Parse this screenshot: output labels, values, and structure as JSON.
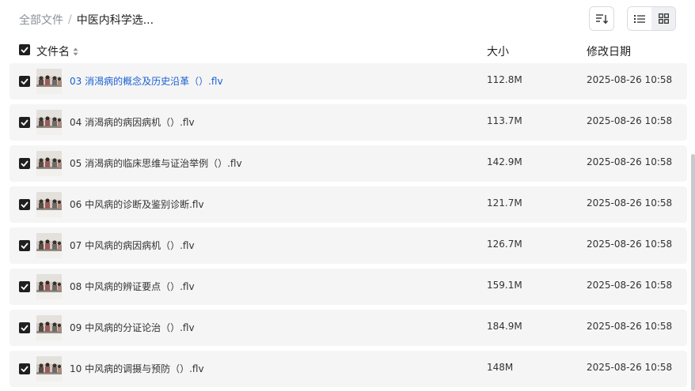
{
  "breadcrumb": {
    "root": "全部文件",
    "separator": "/",
    "current": "中医内科学选..."
  },
  "header": {
    "name": "文件名",
    "size": "大小",
    "modified": "修改日期"
  },
  "files": [
    {
      "name": "03 消渴病的概念及历史沿革（）.flv",
      "size": "112.8M",
      "modified": "2025-08-26 10:58",
      "highlighted": true
    },
    {
      "name": "04 消渴病的病因病机（）.flv",
      "size": "113.7M",
      "modified": "2025-08-26 10:58",
      "highlighted": false
    },
    {
      "name": "05 消渴病的临床思维与证治举例（）.flv",
      "size": "142.9M",
      "modified": "2025-08-26 10:58",
      "highlighted": false
    },
    {
      "name": "06 中风病的诊断及鉴别诊断.flv",
      "size": "121.7M",
      "modified": "2025-08-26 10:58",
      "highlighted": false
    },
    {
      "name": "07 中风病的病因病机（）.flv",
      "size": "126.7M",
      "modified": "2025-08-26 10:58",
      "highlighted": false
    },
    {
      "name": "08 中风病的辨证要点（）.flv",
      "size": "159.1M",
      "modified": "2025-08-26 10:58",
      "highlighted": false
    },
    {
      "name": "09 中风病的分证论治（）.flv",
      "size": "184.9M",
      "modified": "2025-08-26 10:58",
      "highlighted": false
    },
    {
      "name": "10 中风病的调摄与预防（）.flv",
      "size": "148M",
      "modified": "2025-08-26 10:58",
      "highlighted": false
    }
  ],
  "icons": {
    "sort": "sort-icon",
    "list_view": "list-view-icon",
    "grid_view": "grid-view-icon",
    "checkbox": "checkbox-checked-icon",
    "sort_arrows": "sort-arrows-icon"
  },
  "colors": {
    "link": "#1a5fd1",
    "row_bg": "#f5f5f6",
    "checkbox": "#1f1f1f"
  }
}
